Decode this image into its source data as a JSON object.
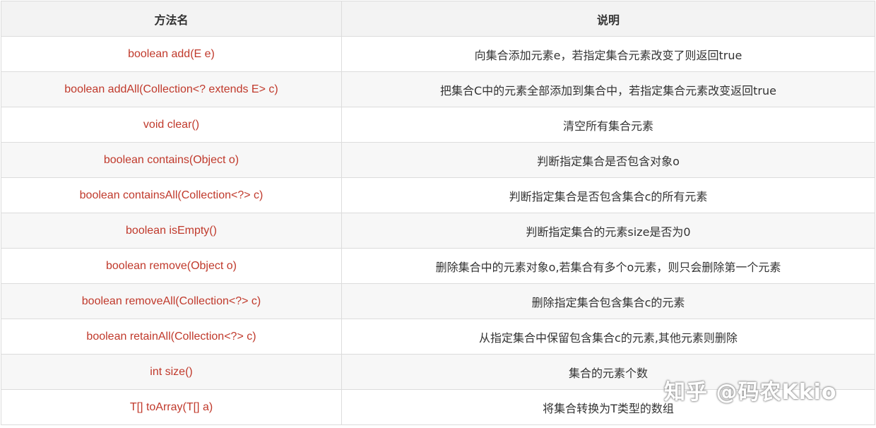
{
  "table": {
    "headers": [
      "方法名",
      "说明"
    ],
    "rows": [
      [
        "boolean add(E e)",
        "向集合添加元素e，若指定集合元素改变了则返回true"
      ],
      [
        "boolean addAll(Collection<? extends E> c)",
        "把集合C中的元素全部添加到集合中，若指定集合元素改变返回true"
      ],
      [
        "void clear()",
        "清空所有集合元素"
      ],
      [
        "boolean contains(Object o)",
        "判断指定集合是否包含对象o"
      ],
      [
        "boolean containsAll(Collection<?> c)",
        "判断指定集合是否包含集合c的所有元素"
      ],
      [
        "boolean isEmpty()",
        "判断指定集合的元素size是否为0"
      ],
      [
        "boolean remove(Object o)",
        "删除集合中的元素对象o,若集合有多个o元素，则只会删除第一个元素"
      ],
      [
        "boolean removeAll(Collection<?> c)",
        "删除指定集合包含集合c的元素"
      ],
      [
        "boolean retainAll(Collection<?> c)",
        "从指定集合中保留包含集合c的元素,其他元素则删除"
      ],
      [
        "int size()",
        "集合的元素个数"
      ],
      [
        "T[] toArray(T[] a)",
        "将集合转换为T类型的数组"
      ]
    ]
  },
  "watermark": "知乎 @码农Kkio",
  "colors": {
    "method_text": "#c0392b",
    "description_text": "#333333",
    "header_bg": "#f3f3f3",
    "stripe_bg": "#f7f7f7",
    "border": "#dcdcdc"
  }
}
